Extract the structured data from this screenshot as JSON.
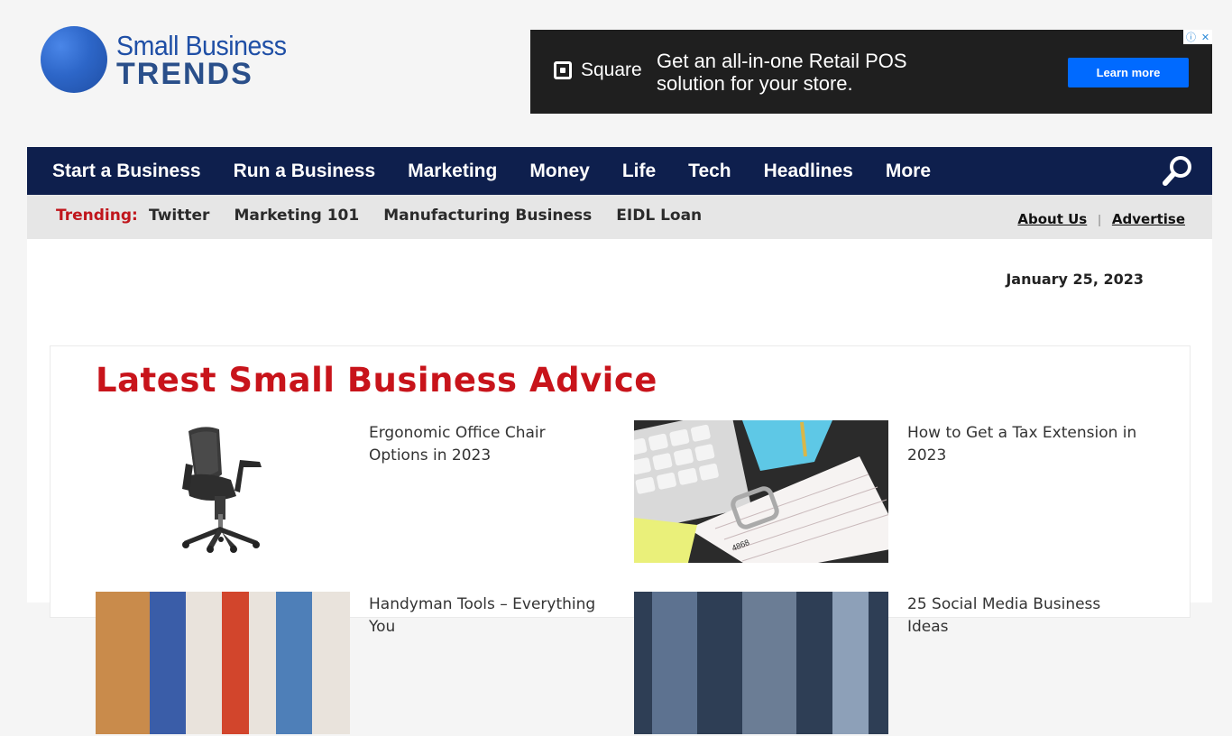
{
  "logo": {
    "line1": "Small Business",
    "line2": "TRENDS"
  },
  "ad": {
    "brand": "Square",
    "headline_1": "Get an all-in-one Retail POS",
    "headline_2": "solution for your store.",
    "cta": "Learn more"
  },
  "nav": {
    "items": [
      "Start a Business",
      "Run a Business",
      "Marketing",
      "Money",
      "Life",
      "Tech",
      "Headlines",
      "More"
    ]
  },
  "trending": {
    "label": "Trending:",
    "links": [
      "Twitter",
      "Marketing 101",
      "Manufacturing Business",
      "EIDL Loan"
    ],
    "about": "About Us",
    "separator": "|",
    "advertise": "Advertise"
  },
  "date": "January 25, 2023",
  "advice": {
    "title": "Latest Small Business Advice",
    "articles": [
      {
        "title": "Ergonomic Office Chair Options in 2023"
      },
      {
        "title": "How to Get a Tax Extension in 2023"
      },
      {
        "title": "Handyman Tools – Everything You"
      },
      {
        "title": "25 Social Media Business Ideas"
      }
    ]
  },
  "colors": {
    "nav_bg": "#0e1f4d",
    "accent_red": "#c8141b",
    "ad_cta": "#006aff"
  }
}
